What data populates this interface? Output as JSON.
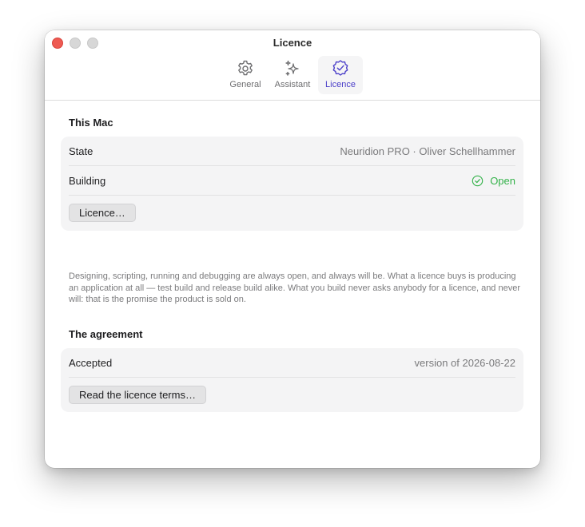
{
  "window": {
    "title": "Licence"
  },
  "tabs": [
    {
      "label": "General",
      "icon": "gear-icon",
      "selected": false
    },
    {
      "label": "Assistant",
      "icon": "sparkles-icon",
      "selected": false
    },
    {
      "label": "Licence",
      "icon": "checkmark-seal-icon",
      "selected": true
    }
  ],
  "this_mac": {
    "title": "This Mac",
    "state_label": "State",
    "state_value": "Neuridion PRO · Oliver Schellhammer",
    "building_label": "Building",
    "building_value": "Open",
    "licence_button": "Licence…",
    "footnote": "Designing, scripting, running and debugging are always open, and always will be. What a licence buys is producing an application at all — test build and release build alike. What you build never asks anybody for a licence, and never will: that is the promise the product is sold on."
  },
  "agreement": {
    "title": "The agreement",
    "accepted_label": "Accepted",
    "accepted_value": "version of 2026-08-22",
    "terms_button": "Read the licence terms…"
  },
  "colors": {
    "accent": "#4b3fc9",
    "status_open": "#34b24a",
    "close": "#ee5a52"
  }
}
